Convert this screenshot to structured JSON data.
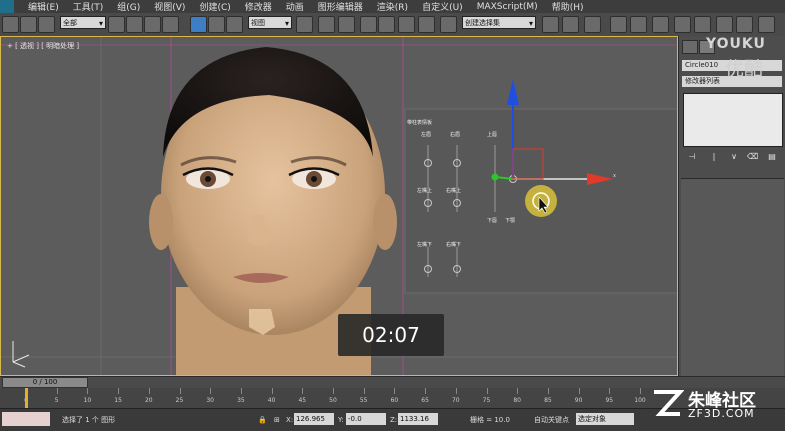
{
  "menu": {
    "items": [
      "编辑(E)",
      "工具(T)",
      "组(G)",
      "视图(V)",
      "创建(C)",
      "修改器",
      "动画",
      "图形编辑器",
      "渲染(R)",
      "自定义(U)",
      "MAXScript(M)",
      "帮助(H)"
    ]
  },
  "toolbar": {
    "selection_filter": "全部",
    "coord_system": "视图",
    "named_selection": "创建选择集"
  },
  "viewport": {
    "label": "+ [ 透视 ] [ 明暗处理 ]",
    "controls": {
      "title": "带柱表情板",
      "left_brow": "左眉",
      "right_brow": "右眉",
      "upper_lip": "上唇",
      "left_lip_up": "左嘴上",
      "right_lip_up": "右嘴上",
      "lower_lip": "下唇",
      "jaw_down": "下颚",
      "left_lip_down": "左嘴下",
      "right_lip_down": "右嘴下"
    },
    "gizmo_axis_label": "x"
  },
  "panel": {
    "object_name": "Circle010",
    "modifier_list": "修改器列表"
  },
  "timeline": {
    "position": "0 / 100",
    "current_frame": 0,
    "total_frames": 100,
    "ticks": [
      "0",
      "5",
      "10",
      "15",
      "20",
      "25",
      "30",
      "35",
      "40",
      "45",
      "50",
      "55",
      "60",
      "65",
      "70",
      "75",
      "80",
      "85",
      "90",
      "95",
      "100"
    ]
  },
  "status": {
    "message": "选择了 1 个 图形",
    "x_label": "X:",
    "x_value": "126.965",
    "y_label": "Y:",
    "y_value": "-0.0",
    "z_label": "Z:",
    "z_value": "1133.16",
    "grid": "栅格 = 10.0",
    "auto_key": "自动关键点",
    "key_filter": "选定对象"
  },
  "overlay": {
    "timer": "02:07",
    "watermark_top": "YOUKU",
    "watermark_top_cn": "优酷",
    "brand_cn": "朱峰社区",
    "brand_en": "ZF3D.COM"
  },
  "colors": {
    "viewport_border": "#d9b84c",
    "gizmo_x": "#e03a2a",
    "gizmo_y": "#2ac62a",
    "gizmo_z": "#1f4fe0",
    "cursor_highlight": "#d8c23a"
  }
}
